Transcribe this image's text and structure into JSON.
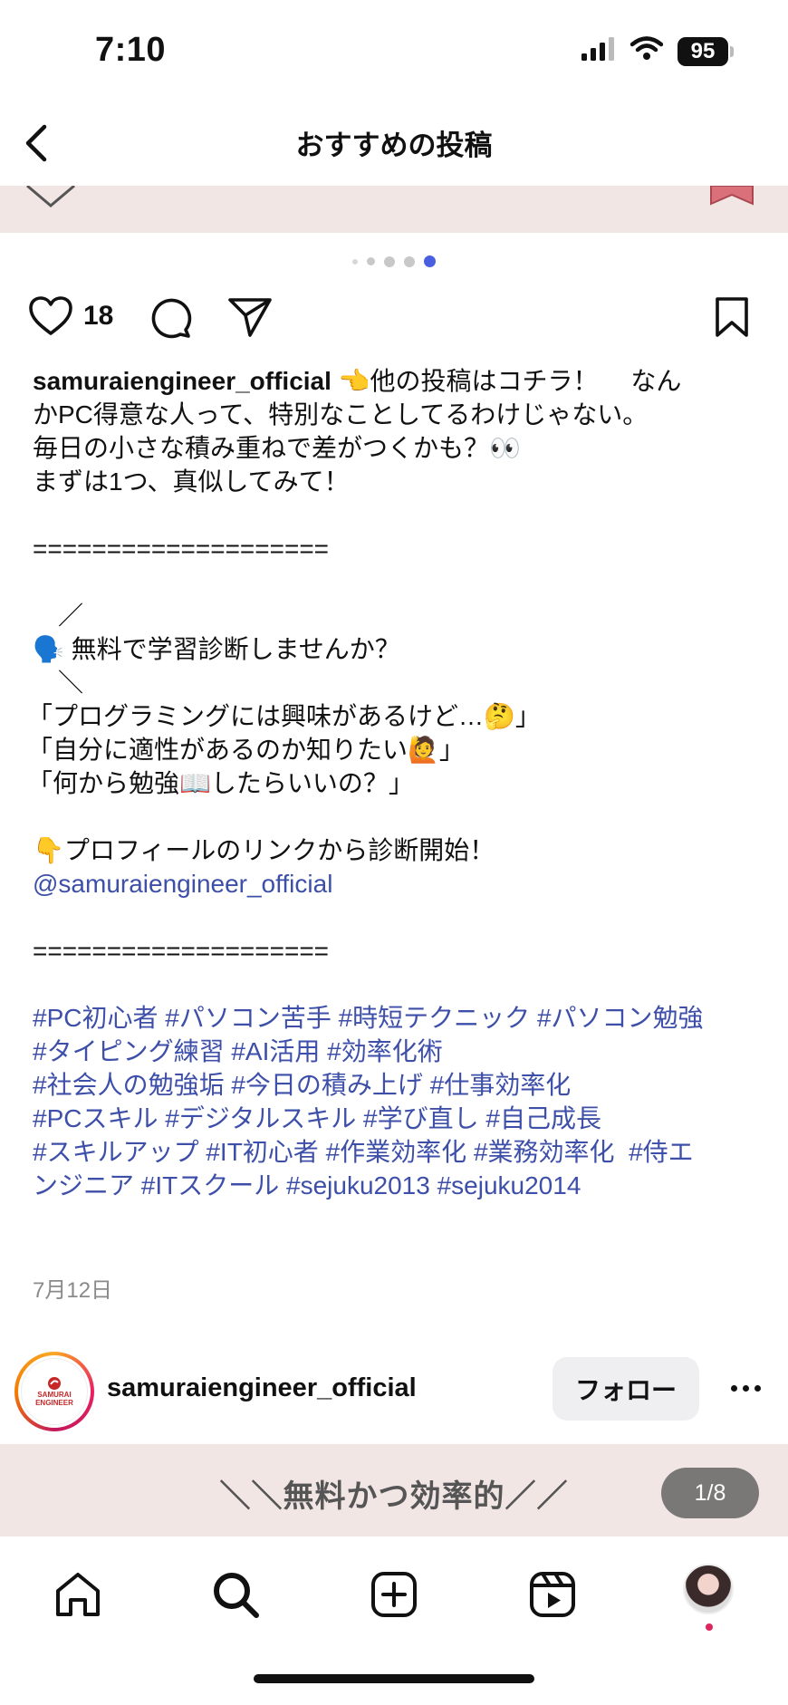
{
  "status_bar": {
    "time": "7:10",
    "battery": "95"
  },
  "header": {
    "title": "おすすめの投稿"
  },
  "carousel": {
    "dot_count": 5,
    "active_index": 4
  },
  "actions": {
    "like_count": "18"
  },
  "caption": {
    "username": "samuraiengineer_official",
    "first_line_rest": " 👈他の投稿はコチラ！　 なん",
    "lines": [
      "かPC得意な人って、特別なことしてるわけじゃない。",
      "毎日の小さな積み重ねで差がつくかも？👀",
      "まずは1つ、真似してみて！"
    ],
    "divider": "====================",
    "callout": [
      "　／",
      "🗣️ 無料で学習診断しませんか？",
      "　＼"
    ],
    "quotes": [
      "「プログラミングには興味があるけど…🤔」",
      "「自分に適性があるのか知りたい🙋」",
      "「何から勉強📖したらいいの？」"
    ],
    "cta": "👇プロフィールのリンクから診断開始！",
    "mention": "@samuraiengineer_official",
    "hashtag_lines": [
      "#PC初心者 #パソコン苦手 #時短テクニック #パソコン勉強",
      "#タイピング練習 #AI活用 #効率化術",
      "#社会人の勉強垢 #今日の積み上げ #仕事効率化",
      "#PCスキル #デジタルスキル #学び直し #自己成長",
      "#スキルアップ #IT初心者 #作業効率化 #業務効率化  #侍エ",
      "ンジニア #ITスクール #sejuku2013 #sejuku2014"
    ]
  },
  "date": "7月12日",
  "next_post": {
    "avatar_logo": "SAMURAI ENGINEER",
    "username": "samuraiengineer_official",
    "follow_label": "フォロー",
    "image_text": "＼＼無料かつ効率的／／",
    "page_counter": "1/8"
  },
  "colors": {
    "link": "#3d4fa8",
    "active_dot": "#4a5fe0",
    "image_bg": "#f1e6e4"
  }
}
